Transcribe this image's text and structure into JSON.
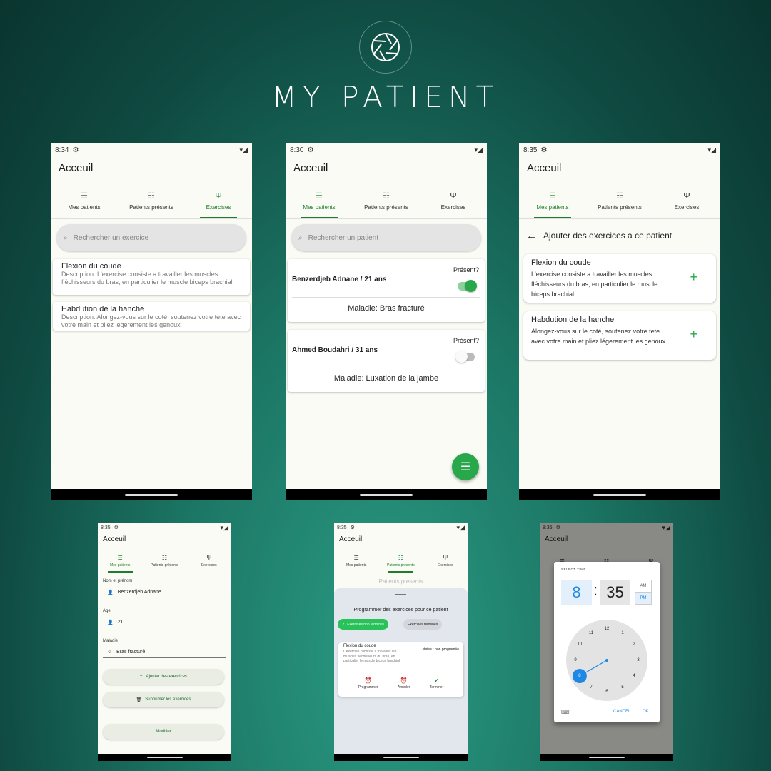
{
  "brand": {
    "title": "MY PATIENT",
    "logo_icon": "camera-aperture-icon"
  },
  "colors": {
    "accent": "#1d7d2c",
    "green_button": "#28a84a",
    "clock_blue": "#1e88e5"
  },
  "screens": [
    {
      "time": "8:34",
      "header": "Acceuil",
      "tabs": [
        "Mes patients",
        "Patients présents",
        "Exercises"
      ],
      "active_tab": 2,
      "search_placeholder": "Rechercher un exercice",
      "exercises": [
        {
          "title": "Flexion du coude",
          "description": "Description: L'exercise consiste a travailler les muscles fléchisseurs du bras, en particulier le muscle biceps brachial"
        },
        {
          "title": "Habdution de la hanche",
          "description": "Description: Alongez-vous sur le coté, soutenez votre tete avec votre main et pliez légerement les genoux"
        }
      ]
    },
    {
      "time": "8:30",
      "header": "Acceuil",
      "tabs": [
        "Mes patients",
        "Patients présents",
        "Exercises"
      ],
      "active_tab": 0,
      "search_placeholder": "Rechercher un patient",
      "present_label": "Présent?",
      "patients": [
        {
          "name": "Benzerdjeb Adnane / 21 ans",
          "disease": "Maladie: Bras fracturé",
          "present": true
        },
        {
          "name": "Ahmed Boudahri / 31 ans",
          "disease": "Maladie: Luxation de la jambe",
          "present": false
        }
      ]
    },
    {
      "time": "8:35",
      "header": "Acceuil",
      "tabs": [
        "Mes patients",
        "Patients présents",
        "Exercises"
      ],
      "active_tab": 0,
      "subheader": "Ajouter des exercices a ce patient",
      "exercises": [
        {
          "title": "Flexion du coude",
          "description": "L'exercise consiste a travailler les muscles fléchisseurs du bras, en particulier le muscle biceps brachial"
        },
        {
          "title": "Habdution de la hanche",
          "description": "Alongez-vous sur le coté, soutenez votre tete avec votre main et pliez légerement les genoux"
        }
      ]
    },
    {
      "time": "8:35",
      "header": "Acceuil",
      "tabs": [
        "Mes patients",
        "Patients présents",
        "Exercises"
      ],
      "active_tab": 0,
      "fields": [
        {
          "label": "Nom et prénom",
          "value": "Benzerdjeb Adnane"
        },
        {
          "label": "Age",
          "value": "21"
        },
        {
          "label": "Maladie",
          "value": "Bras fracturé"
        }
      ],
      "buttons": {
        "add": "Ajouter des exercices",
        "delete": "Supprimer les exercices",
        "edit": "Modifier"
      }
    },
    {
      "time": "8:35",
      "header": "Acceuil",
      "tabs": [
        "Mes patients",
        "Patients présents",
        "Exercises"
      ],
      "active_tab": 1,
      "list_title": "Patients présents",
      "sheet_title": "Programmer des exercices pour ce patient",
      "chips": [
        "Exercises non terminés",
        "Exercises terminés"
      ],
      "exercise": {
        "title": "Flexion du coude",
        "description": "L'exercise consiste a travailler les muscles fléchisseurs du bras, en particulier le muscle biceps brachial",
        "status": "status : non programée"
      },
      "actions": [
        "Programmer",
        "Annuler",
        "Terminer"
      ]
    },
    {
      "time": "8:35",
      "header": "Acceuil",
      "dialog": {
        "label": "SELECT TIME",
        "hour": "8",
        "minute": "35",
        "am": "AM",
        "pm": "PM",
        "cancel": "CANCEL",
        "ok": "OK",
        "selected_hour": 8,
        "numbers": [
          "12",
          "1",
          "2",
          "3",
          "4",
          "5",
          "6",
          "7",
          "8",
          "9",
          "10",
          "11"
        ]
      }
    }
  ]
}
